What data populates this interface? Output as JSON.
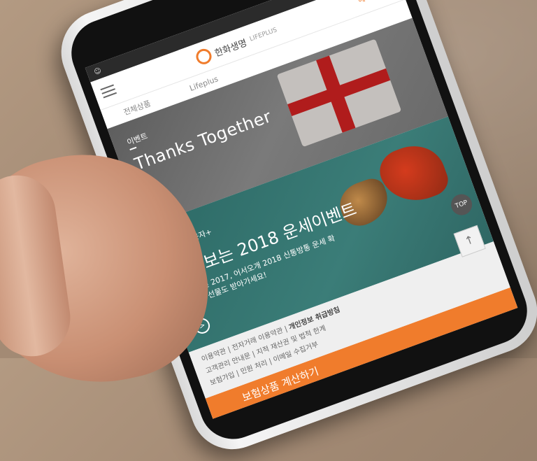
{
  "status": {
    "time": "",
    "left_icon": "app-icon"
  },
  "header": {
    "brand_name": "한화생명",
    "brand_sub": "LIFEPLUS",
    "event_link": "혜택/이벤트",
    "sub_brand": "Lifeplus"
  },
  "subnav": {
    "all_products": "전체상품"
  },
  "banner1": {
    "tag": "이벤트",
    "title": "Thanks Together",
    "more": ">"
  },
  "banner2": {
    "tag": "온가족라운자+",
    "title": "미리보는 2018 운세이벤트",
    "description": "즐거웠던 2017, 어서오개 2018 신통방통 운세 확인하고 선물도 받아가세요!",
    "more": ">",
    "top_label": "TOP"
  },
  "footer": {
    "links_row1": "이용약관 | 전자거래 이용약관 |",
    "privacy": "개인정보 취급방침",
    "links_row2": "고객관리 안내문 | 지적 재산권 및 법적 한계",
    "links_row3": "보험가입 | 민원 처리 | 이메일 수집거부",
    "scroll_top": "↑"
  },
  "calc_bar": {
    "label": "보험상품 계산하기"
  },
  "bottom_nav": {
    "share": "↗",
    "more": "···"
  },
  "colors": {
    "accent": "#f07c2c",
    "banner2_bg": "#2d6a66",
    "banner1_bg": "#6a6a6a"
  }
}
